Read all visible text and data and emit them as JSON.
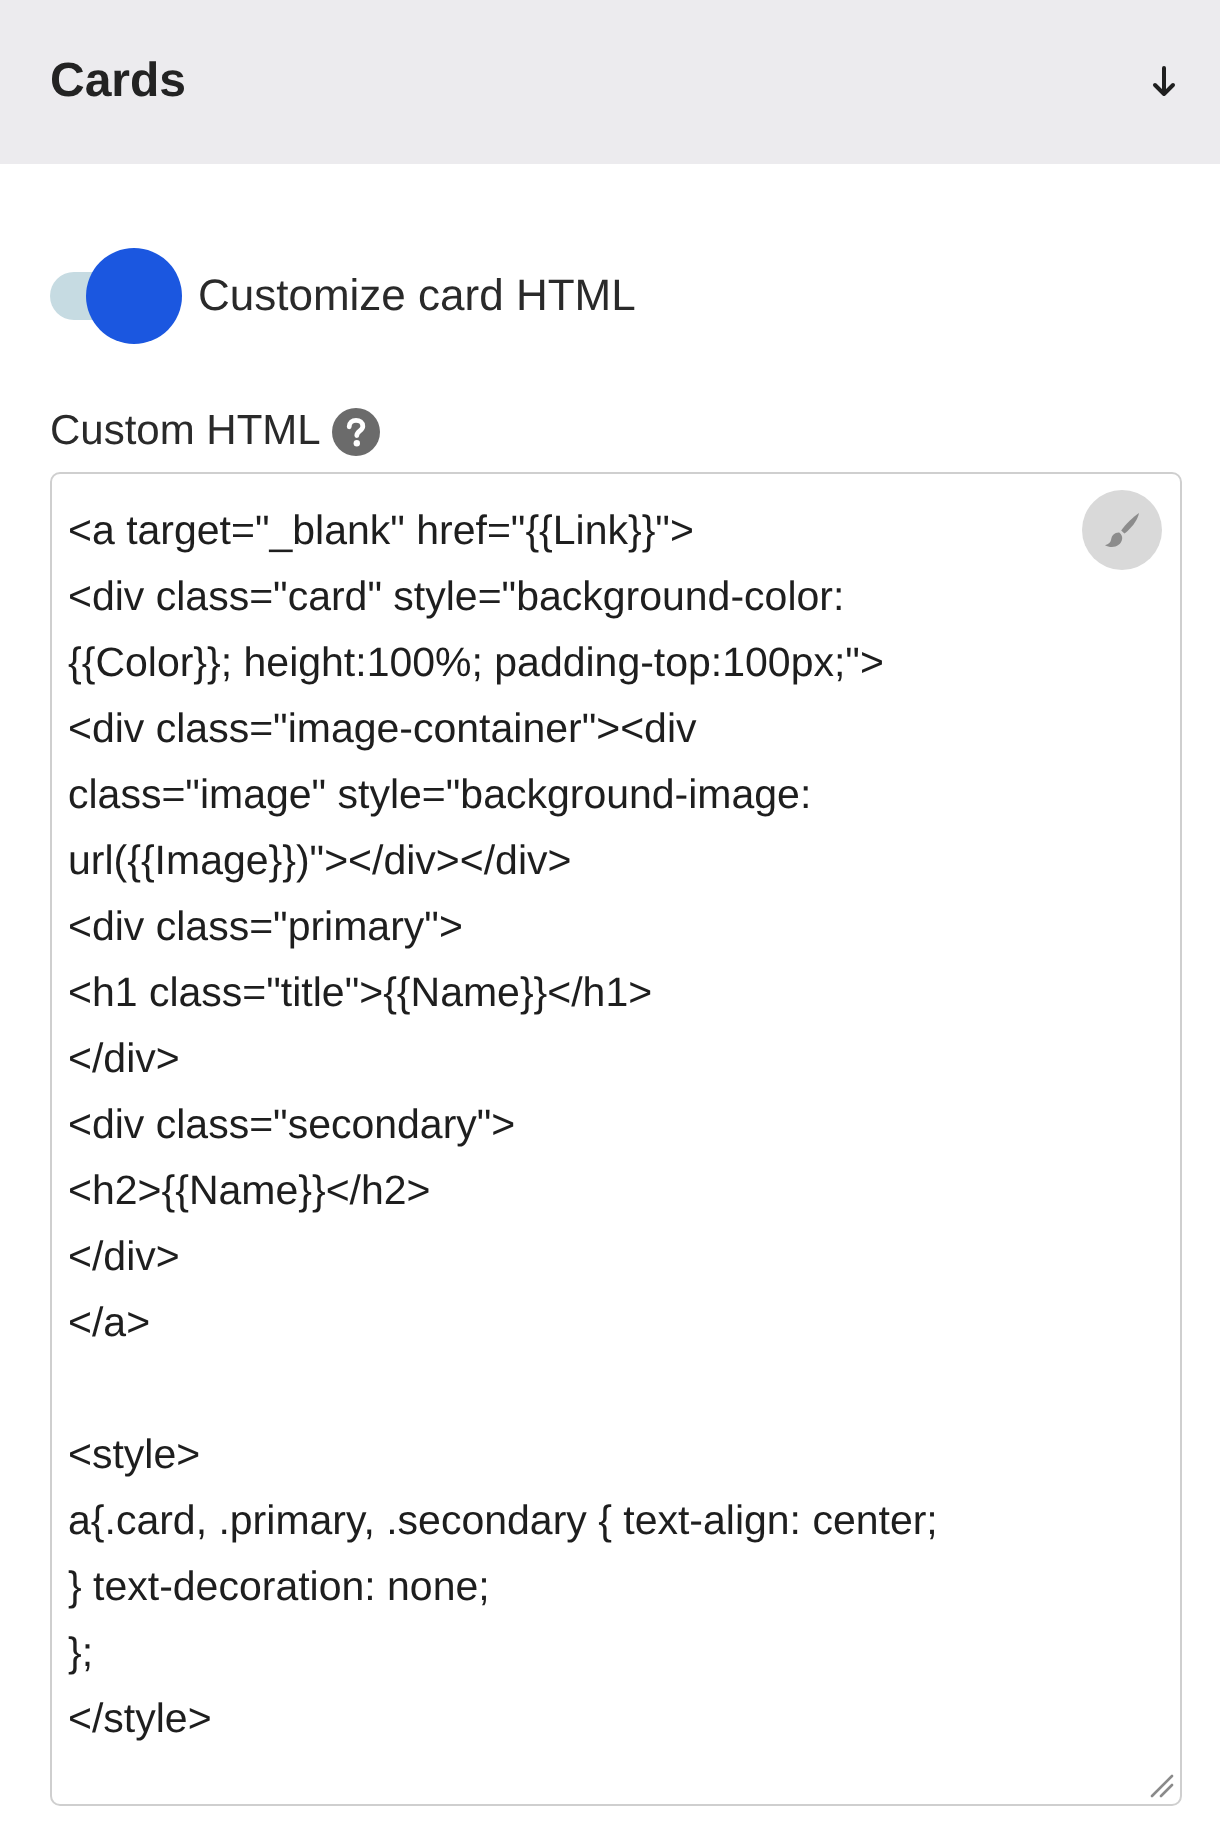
{
  "section": {
    "title": "Cards"
  },
  "toggle": {
    "label": "Customize card HTML",
    "on": true
  },
  "custom_html": {
    "label": "Custom HTML",
    "value": "<a target=\"_blank\" href=\"{{Link}}\">\n<div class=\"card\" style=\"background-color:\n{{Color}}; height:100%; padding-top:100px;\">\n<div class=\"image-container\"><div\nclass=\"image\" style=\"background-image:\nurl({{Image}})\"></div></div>\n<div class=\"primary\">\n<h1 class=\"title\">{{Name}}</h1>\n</div>\n<div class=\"secondary\">\n<h2>{{Name}}</h2>\n</div>\n</a>\n\n<style>\na{.card, .primary, .secondary { text-align: center;\n} text-decoration: none;\n};\n</style>"
  }
}
